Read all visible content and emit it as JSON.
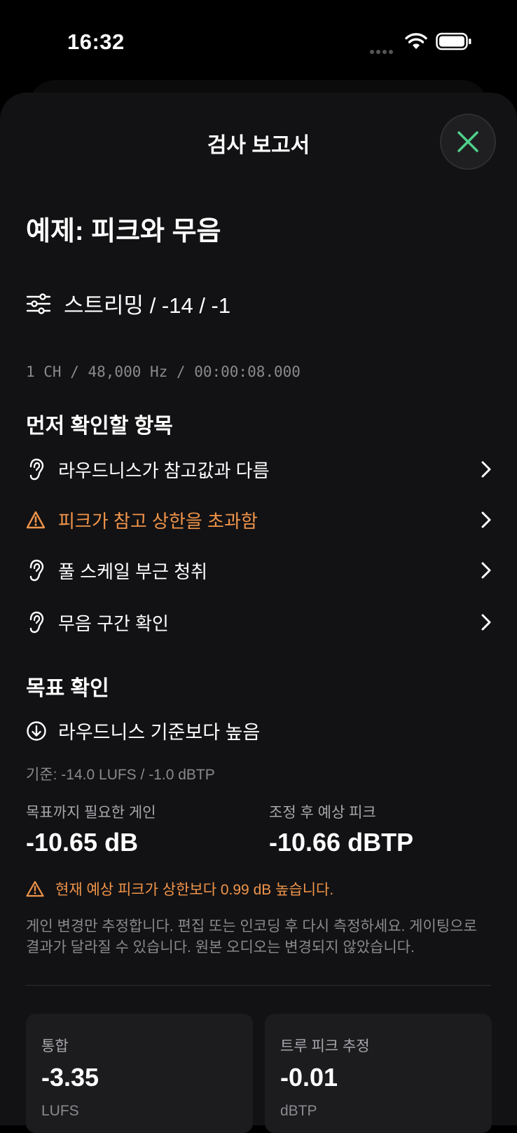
{
  "status_bar": {
    "time": "16:32"
  },
  "sheet": {
    "title": "검사 보고서"
  },
  "report": {
    "title": "예제: 피크와 무음",
    "preset": "스트리밍 / -14 / -1",
    "meta": "1 CH / 48,000 Hz / 00:00:08.000"
  },
  "first_checks": {
    "heading": "먼저 확인할 항목",
    "items": [
      {
        "label": "라우드니스가 참고값과 다름",
        "icon": "ear-icon",
        "warning": false
      },
      {
        "label": "피크가 참고 상한을 초과함",
        "icon": "warning-triangle-icon",
        "warning": true
      },
      {
        "label": "풀 스케일 부근 청취",
        "icon": "ear-icon",
        "warning": false
      },
      {
        "label": "무음 구간 확인",
        "icon": "ear-icon",
        "warning": false
      }
    ]
  },
  "target": {
    "heading": "목표 확인",
    "status": "라우드니스 기준보다 높음",
    "criteria": "기준: -14.0 LUFS / -1.0 dBTP",
    "gain_label": "목표까지 필요한 게인",
    "gain_value": "-10.65 dB",
    "peak_label": "조정 후 예상 피크",
    "peak_value": "-10.66 dBTP",
    "peak_warning": "현재 예상 피크가 상한보다 0.99 dB 높습니다.",
    "disclaimer_line1": "게인 변경만 추정합니다. 편집 또는 인코딩 후 다시 측정하세요. 게이팅으로",
    "disclaimer_line2": "결과가 달라질 수 있습니다. 원본 오디오는 변경되지 않았습니다."
  },
  "stats": [
    {
      "label": "통합",
      "value": "-3.35",
      "unit": "LUFS"
    },
    {
      "label": "트루 피크 추정",
      "value": "-0.01",
      "unit": "dBTP"
    }
  ],
  "colors": {
    "accent_green": "#4fd08a",
    "warning_orange": "#f0944a",
    "background": "#121214"
  }
}
